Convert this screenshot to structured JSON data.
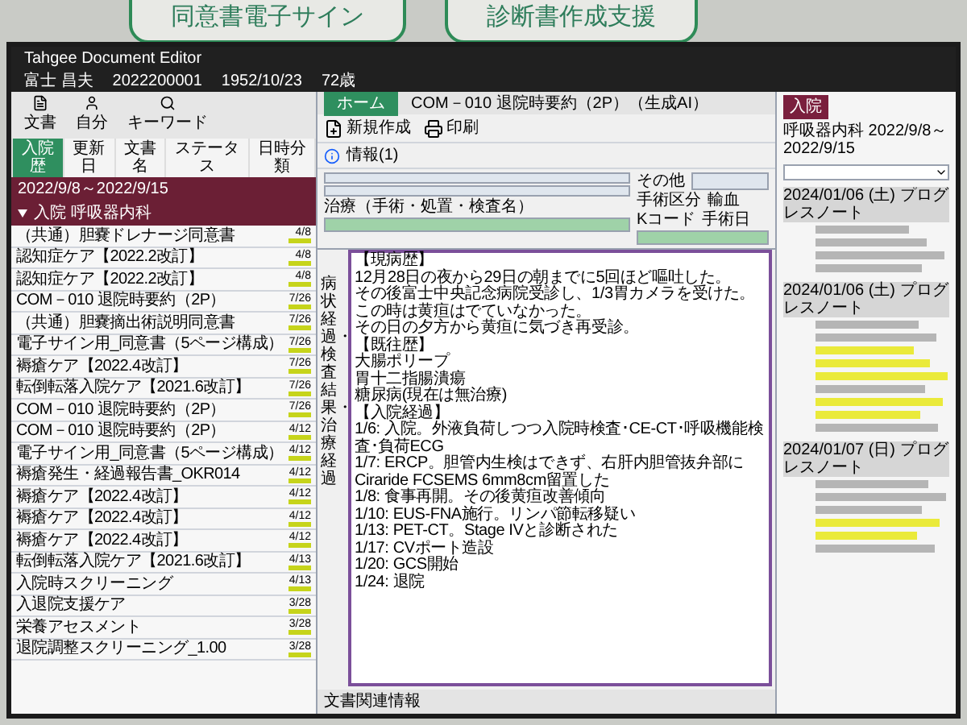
{
  "signs": [
    "同意書電子サイン",
    "診断書作成支援"
  ],
  "window": {
    "title": "Tahgee Document Editor"
  },
  "patient": {
    "name": "富士 昌夫",
    "id": "2022200001",
    "birth": "1952/10/23",
    "age": "72歳"
  },
  "left_toolbar": [
    "文書",
    "自分",
    "キーワード"
  ],
  "filter_buttons": [
    {
      "label": "入院歴",
      "selected": true
    },
    {
      "label": "更新日",
      "selected": false
    },
    {
      "label": "文書名",
      "selected": false
    },
    {
      "label": "ステータス",
      "selected": false
    },
    {
      "label": "日時分類",
      "selected": false
    }
  ],
  "period": "2022/9/8～2022/9/15",
  "group": {
    "label": "入院 呼吸器内科",
    "expanded": true
  },
  "documents": [
    {
      "title": "（共通）胆嚢ドレナージ同意書",
      "date": "4/8"
    },
    {
      "title": "認知症ケア【2022.2改訂】",
      "date": "4/8"
    },
    {
      "title": "認知症ケア【2022.2改訂】",
      "date": "4/8"
    },
    {
      "title": "COM－010 退院時要約（2P）",
      "date": "7/26"
    },
    {
      "title": "（共通）胆嚢摘出術説明同意書",
      "date": "7/26"
    },
    {
      "title": "電子サイン用_同意書（5ページ構成）",
      "date": "7/26"
    },
    {
      "title": "褥瘡ケア【2022.4改訂】",
      "date": "7/26"
    },
    {
      "title": "転倒転落入院ケア【2021.6改訂】",
      "date": "7/26"
    },
    {
      "title": "COM－010 退院時要約（2P）",
      "date": "7/26"
    },
    {
      "title": "COM－010 退院時要約（2P）",
      "date": "4/12"
    },
    {
      "title": "電子サイン用_同意書（5ページ構成）",
      "date": "4/12"
    },
    {
      "title": "褥瘡発生・経過報告書_OKR014",
      "date": "4/12"
    },
    {
      "title": "褥瘡ケア【2022.4改訂】",
      "date": "4/12"
    },
    {
      "title": "褥瘡ケア【2022.4改訂】",
      "date": "4/12"
    },
    {
      "title": "褥瘡ケア【2022.4改訂】",
      "date": "4/12"
    },
    {
      "title": "転倒転落入院ケア【2021.6改訂】",
      "date": "4/13"
    },
    {
      "title": "入院時スクリーニング",
      "date": "4/13"
    },
    {
      "title": "入退院支援ケア",
      "date": "3/28"
    },
    {
      "title": "栄養アセスメント",
      "date": "3/28"
    },
    {
      "title": "退院調整スクリーニング_1.00",
      "date": "3/28"
    }
  ],
  "editor": {
    "tabs": [
      {
        "label": "ホーム",
        "selected": true
      }
    ],
    "ribbon": [
      "新規作成",
      "印刷"
    ],
    "document_title": "COM－010 退院時要約（2P）（生成AI）",
    "tree_item": "情報(1)",
    "other_label": "その他",
    "surgery_class_label": "手術区分",
    "transfusion_label": "輸血",
    "treatment_label": "治療（手術・処置・検査名）",
    "kcode_label": "Kコード",
    "surgery_date_label": "手術日",
    "section_label": "病状経過・検査結果・治療経過",
    "text": [
      "【現病歴】",
      "12月28日の夜から29日の朝までに5回ほど嘔吐した。",
      "その後富士中央記念病院受診し、1/3胃カメラを受けた。",
      "この時は黄疸はでていなかった。",
      "その日の夕方から黄疸に気づき再受診。",
      "【既往歴】",
      "大腸ポリープ",
      "胃十二指腸潰瘍",
      "糖尿病(現在は無治療)",
      "【入院経過】",
      "1/6: 入院。外液負荷しつつ入院時検査･CE-CT･呼吸機能検査･負荷ECG",
      "1/7: ERCP。胆管内生検はできず、右肝内胆管抜弁部にCiraride FCSEMS 6mm8cm留置した",
      "1/8: 食事再開。その後黄疸改善傾向",
      "1/10: EUS-FNA施行。リンパ節転移疑い",
      "1/13: PET-CT。Stage IVと診断された",
      "1/17: CVポート造設",
      "1/20: GCS開始",
      "1/24: 退院"
    ],
    "footer": "文書関連情報"
  },
  "notes_panel": {
    "badge": "入院",
    "header": "呼吸器内科 2022/9/8～2022/9/15",
    "notes": [
      {
        "heading": "2024/01/06 (土) プログレスノート",
        "lines": [
          {
            "highlighted": false
          },
          {
            "highlighted": false
          },
          {
            "highlighted": false
          },
          {
            "highlighted": false
          }
        ]
      },
      {
        "heading": "2024/01/06 (土) プログレスノート",
        "lines": [
          {
            "highlighted": false
          },
          {
            "highlighted": false
          },
          {
            "highlighted": true
          },
          {
            "highlighted": true
          },
          {
            "highlighted": true
          },
          {
            "highlighted": false
          },
          {
            "highlighted": true
          },
          {
            "highlighted": true
          },
          {
            "highlighted": false
          }
        ]
      },
      {
        "heading": "2024/01/07 (日) プログレスノート",
        "lines": [
          {
            "highlighted": false
          },
          {
            "highlighted": false
          },
          {
            "highlighted": false
          },
          {
            "highlighted": true
          },
          {
            "highlighted": true
          },
          {
            "highlighted": false
          }
        ]
      }
    ]
  }
}
